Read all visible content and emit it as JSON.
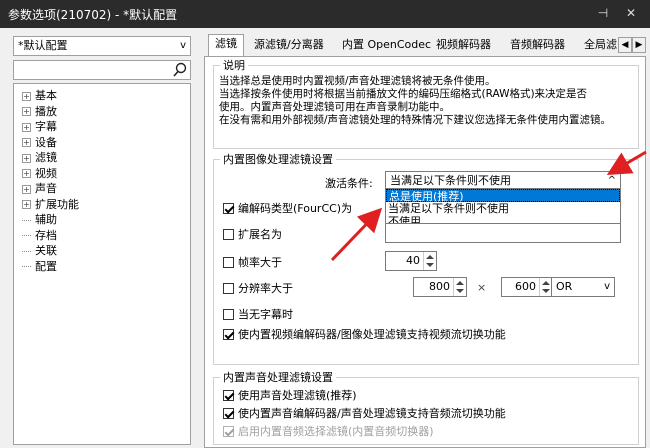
{
  "window": {
    "title": "参数选项(210702) - *默认配置"
  },
  "sidebar": {
    "preset_value": "*默认配置",
    "search_value": "",
    "items": [
      {
        "label": "基本",
        "expandable": true
      },
      {
        "label": "播放",
        "expandable": true
      },
      {
        "label": "字幕",
        "expandable": true
      },
      {
        "label": "设备",
        "expandable": true
      },
      {
        "label": "滤镜",
        "expandable": true
      },
      {
        "label": "视频",
        "expandable": true
      },
      {
        "label": "声音",
        "expandable": true
      },
      {
        "label": "扩展功能",
        "expandable": true
      },
      {
        "label": "辅助",
        "expandable": false
      },
      {
        "label": "存档",
        "expandable": false
      },
      {
        "label": "关联",
        "expandable": false
      },
      {
        "label": "配置",
        "expandable": false
      }
    ]
  },
  "tabs": [
    {
      "label": "滤镜",
      "active": true
    },
    {
      "label": "源滤镜/分离器",
      "active": false
    },
    {
      "label": "内置 OpenCodec",
      "active": false
    },
    {
      "label": "视频解码器",
      "active": false
    },
    {
      "label": "音频解码器",
      "active": false
    },
    {
      "label": "全局滤",
      "active": false
    }
  ],
  "description": {
    "title": "说明",
    "lines": [
      "当选择总是使用时内置视频/声音处理滤镜将被无条件使用。",
      "当选择按条件使用时将根据当前播放文件的编码压缩格式(RAW格式)来决定是否",
      "使用。内置声音处理滤镜可用在声音录制功能中。",
      "在没有需和用外部视频/声音滤镜处理的特殊情况下建议您选择无条件使用内置滤镜。"
    ]
  },
  "video_filter": {
    "title": "内置图像处理滤镜设置",
    "activation_label": "激活条件:",
    "activation_value": "当满足以下条件则不使用",
    "activation_options": [
      {
        "label": "总是使用(推荐)",
        "selected": true
      },
      {
        "label": "当满足以下条件则不使用",
        "selected": false
      },
      {
        "label": "不使用",
        "selected": false
      }
    ],
    "fourcc_label": "编解码类型(FourCC)为",
    "fourcc_checked": true,
    "extension_label": "扩展名为",
    "extension_checked": false,
    "framerate_label": "帧率大于",
    "framerate_checked": false,
    "framerate_value": "40",
    "resolution_label": "分辨率大于",
    "resolution_checked": false,
    "resolution_w": "800",
    "resolution_times": "×",
    "resolution_h": "600",
    "resolution_op": "OR",
    "no_subtitle_label": "当无字幕时",
    "no_subtitle_checked": false,
    "stream_switch_label": "使内置视频编解码器/图像处理滤镜支持视频流切换功能",
    "stream_switch_checked": true
  },
  "audio_filter": {
    "title": "内置声音处理滤镜设置",
    "use_label": "使用声音处理滤镜(推荐)",
    "use_checked": true,
    "switch_label": "使内置声音编解码器/声音处理滤镜支持音频流切换功能",
    "switch_checked": true,
    "select_label": "启用内置音频选择滤镜(内置音频切换器)",
    "select_checked": true
  },
  "colors": {
    "accent": "#0078d7",
    "arrow": "#e02020",
    "titlebar": "#2b2b2b"
  }
}
